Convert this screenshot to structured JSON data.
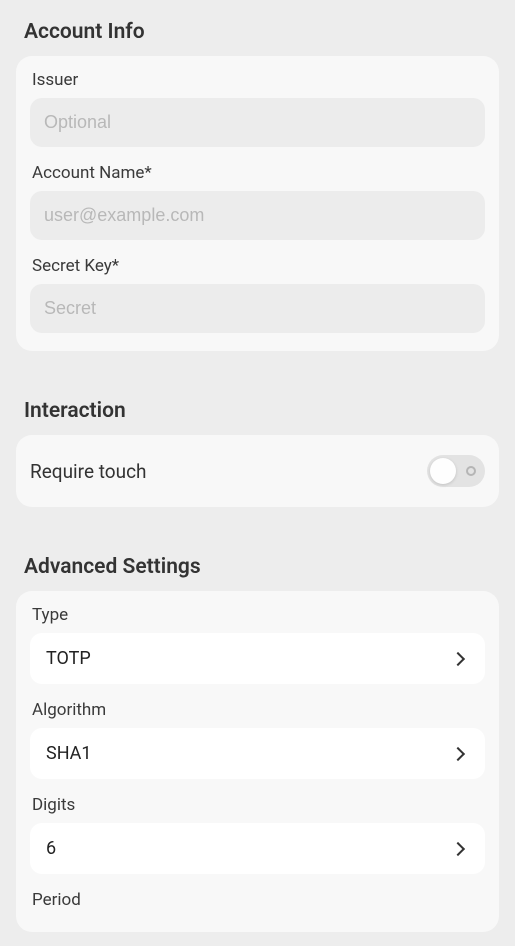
{
  "accountInfo": {
    "title": "Account Info",
    "issuer": {
      "label": "Issuer",
      "placeholder": "Optional",
      "value": ""
    },
    "accountName": {
      "label": "Account Name*",
      "placeholder": "user@example.com",
      "value": ""
    },
    "secretKey": {
      "label": "Secret Key*",
      "placeholder": "Secret",
      "value": ""
    }
  },
  "interaction": {
    "title": "Interaction",
    "requireTouch": {
      "label": "Require touch",
      "value": false
    }
  },
  "advancedSettings": {
    "title": "Advanced Settings",
    "type": {
      "label": "Type",
      "value": "TOTP"
    },
    "algorithm": {
      "label": "Algorithm",
      "value": "SHA1"
    },
    "digits": {
      "label": "Digits",
      "value": "6"
    },
    "period": {
      "label": "Period",
      "value": ""
    }
  }
}
